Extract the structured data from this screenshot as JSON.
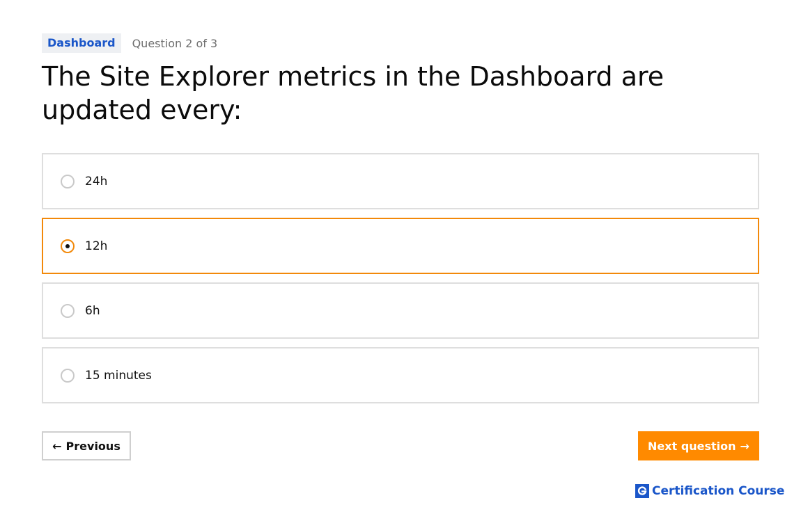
{
  "breadcrumb": {
    "section": "Dashboard",
    "progress": "Question 2 of 3"
  },
  "question": {
    "text": "The Site Explorer metrics in the Dashboard are updated every:"
  },
  "options": [
    {
      "label": "24h",
      "selected": false
    },
    {
      "label": "12h",
      "selected": true
    },
    {
      "label": "6h",
      "selected": false
    },
    {
      "label": "15 minutes",
      "selected": false
    }
  ],
  "navigation": {
    "previous_label": "Previous",
    "previous_arrow": "←",
    "next_label": "Next question",
    "next_arrow": "→"
  },
  "brand": {
    "text": "Certification Course",
    "logo_icon": "g-logo-icon"
  },
  "colors": {
    "accent": "#ff8a00",
    "selected_border": "#f2890a",
    "brand_blue": "#1a56c9"
  }
}
